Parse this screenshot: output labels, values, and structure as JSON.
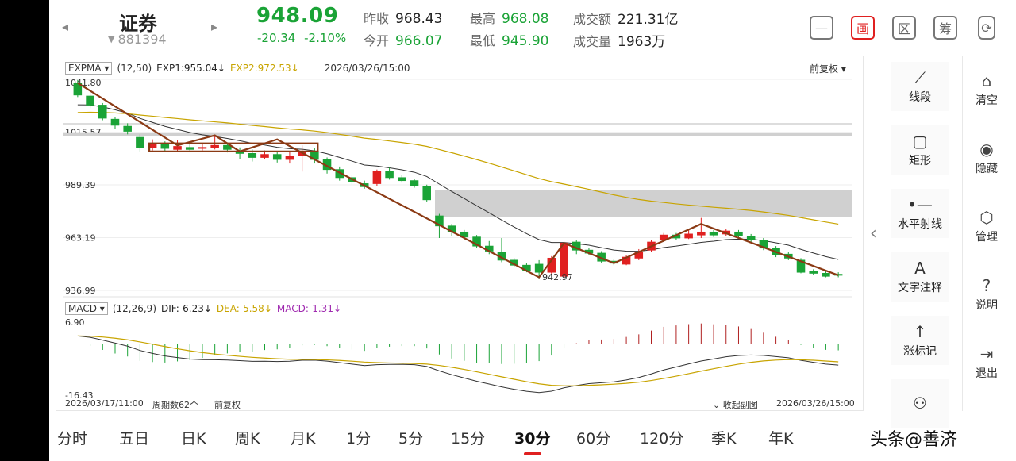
{
  "header": {
    "prev_arrow": "◂",
    "next_arrow": "▸",
    "stock_name": "证券",
    "stock_code": "881394",
    "price": "948.09",
    "change": "-20.34",
    "change_pct": "-2.10%",
    "quotes": [
      {
        "label": "昨收",
        "value": "968.43",
        "color": "black"
      },
      {
        "label": "最高",
        "value": "968.08",
        "color": "green"
      },
      {
        "label": "成交额",
        "value": "221.31亿",
        "color": "black"
      },
      {
        "label": "今开",
        "value": "966.07",
        "color": "green"
      },
      {
        "label": "最低",
        "value": "945.90",
        "color": "green"
      },
      {
        "label": "成交量",
        "value": "1963万",
        "color": "black"
      }
    ],
    "icons": [
      {
        "name": "minimize-icon",
        "glyph": "—"
      },
      {
        "name": "draw-icon",
        "glyph": "画"
      },
      {
        "name": "region-icon",
        "glyph": "区"
      },
      {
        "name": "chips-icon",
        "glyph": "筹"
      },
      {
        "name": "screen-rotate-icon",
        "glyph": "⟳"
      }
    ]
  },
  "legend": {
    "indicator": "EXPMA",
    "params": "(12,50)",
    "exp1": "EXP1:955.04",
    "exp2": "EXP2:972.53",
    "datetime": "2026/03/26/15:00",
    "adjust": "前复权"
  },
  "macd_legend": {
    "indicator": "MACD",
    "params": "(12,26,9)",
    "dif": "DIF:-6.23",
    "dea": "DEA:-5.58",
    "macd": "MACD:-1.31"
  },
  "footer": {
    "start": "2026/03/17/11:00",
    "period_count": "周期数62个",
    "adjust": "前复权",
    "collapse": "收起副图",
    "end": "2026/03/26/15:00"
  },
  "tools": [
    {
      "name": "line-segment",
      "icon": "⟋",
      "label": "线段"
    },
    {
      "name": "rectangle",
      "icon": "▢",
      "label": "矩形"
    },
    {
      "name": "horizontal-ray",
      "icon": "•—",
      "label": "水平射线"
    },
    {
      "name": "text-note",
      "icon": "A",
      "label": "文字注释"
    },
    {
      "name": "limit-up-mark",
      "icon": "↑",
      "label": "涨标记"
    },
    {
      "name": "more-tools",
      "icon": "⚇",
      "label": ""
    }
  ],
  "side_tools": [
    {
      "name": "clear",
      "icon": "⌂",
      "label": "清空"
    },
    {
      "name": "hide",
      "icon": "◉",
      "label": "隐藏"
    },
    {
      "name": "manage",
      "icon": "⬡",
      "label": "管理"
    },
    {
      "name": "help",
      "icon": "?",
      "label": "说明"
    },
    {
      "name": "exit",
      "icon": "⇥",
      "label": "退出"
    }
  ],
  "collapse_arrow": "‹",
  "tabs": [
    "分时",
    "五日",
    "日K",
    "周K",
    "月K",
    "1分",
    "5分",
    "15分",
    "30分",
    "60分",
    "120分",
    "季K",
    "年K"
  ],
  "active_tab": "30分",
  "watermark": "头条@善济",
  "chart_data": {
    "type": "candlestick",
    "y_axis_labels": [
      "1041.80",
      "1015.57",
      "989.39",
      "963.19",
      "936.99"
    ],
    "ylim": [
      936.99,
      1041.8
    ],
    "low_annotation": "942.97",
    "candles": [
      [
        1040.0,
        1034.0,
        1041.5,
        1033.0
      ],
      [
        1033.5,
        1029.0,
        1035.0,
        1027.5
      ],
      [
        1029.0,
        1022.5,
        1030.0,
        1021.5
      ],
      [
        1022.0,
        1019.0,
        1023.0,
        1017.0
      ],
      [
        1018.5,
        1016.0,
        1020.0,
        1014.5
      ],
      [
        1013.0,
        1008.0,
        1014.5,
        1006.0
      ],
      [
        1008.0,
        1009.5,
        1012.0,
        1006.5
      ],
      [
        1009.5,
        1007.5,
        1011.0,
        1006.0
      ],
      [
        1007.0,
        1008.5,
        1011.5,
        1006.0
      ],
      [
        1008.0,
        1007.0,
        1010.5,
        1006.0
      ],
      [
        1007.5,
        1008.0,
        1010.0,
        1006.5
      ],
      [
        1008.0,
        1009.0,
        1013.5,
        1007.0
      ],
      [
        1009.0,
        1007.0,
        1010.5,
        1005.5
      ],
      [
        1006.0,
        1005.0,
        1008.0,
        1002.0
      ],
      [
        1005.0,
        1003.0,
        1007.0,
        1001.0
      ],
      [
        1003.0,
        1004.5,
        1006.5,
        1002.0
      ],
      [
        1004.5,
        1002.0,
        1006.0,
        1000.5
      ],
      [
        1002.0,
        1003.5,
        1006.0,
        1000.0
      ],
      [
        1004.0,
        1005.5,
        1009.0,
        996.0
      ],
      [
        1006.0,
        1002.0,
        1007.5,
        1000.0
      ],
      [
        1002.0,
        997.0,
        1003.0,
        995.0
      ],
      [
        997.0,
        993.0,
        998.5,
        991.5
      ],
      [
        993.0,
        991.0,
        994.5,
        989.5
      ],
      [
        990.0,
        988.5,
        991.5,
        987.5
      ],
      [
        990.0,
        996.0,
        997.0,
        989.0
      ],
      [
        996.0,
        993.0,
        998.0,
        992.0
      ],
      [
        993.0,
        991.5,
        994.5,
        990.5
      ],
      [
        991.5,
        989.0,
        992.5,
        988.0
      ],
      [
        988.5,
        982.0,
        989.5,
        981.0
      ],
      [
        974.0,
        969.0,
        975.0,
        963.0
      ],
      [
        969.0,
        966.0,
        970.0,
        964.0
      ],
      [
        966.0,
        963.5,
        967.0,
        962.0
      ],
      [
        963.5,
        959.0,
        964.5,
        958.0
      ],
      [
        959.0,
        956.5,
        961.5,
        955.0
      ],
      [
        956.0,
        952.0,
        963.0,
        951.0
      ],
      [
        952.0,
        949.5,
        953.0,
        948.5
      ],
      [
        949.5,
        947.0,
        950.5,
        946.0
      ],
      [
        950.0,
        946.0,
        952.0,
        942.97
      ],
      [
        946.0,
        953.0,
        954.0,
        945.0
      ],
      [
        944.0,
        960.5,
        961.5,
        943.0
      ],
      [
        961.0,
        957.0,
        962.0,
        955.0
      ],
      [
        957.0,
        955.5,
        958.0,
        954.5
      ],
      [
        955.5,
        951.5,
        956.5,
        950.5
      ],
      [
        951.5,
        950.5,
        952.5,
        949.5
      ],
      [
        950.0,
        953.5,
        954.5,
        949.5
      ],
      [
        953.0,
        956.0,
        957.5,
        952.0
      ],
      [
        957.0,
        961.0,
        962.0,
        956.0
      ],
      [
        962.0,
        964.5,
        965.5,
        961.0
      ],
      [
        964.5,
        963.0,
        965.5,
        962.0
      ],
      [
        963.0,
        965.0,
        967.0,
        962.5
      ],
      [
        964.5,
        966.0,
        973.0,
        963.0
      ],
      [
        966.0,
        964.5,
        967.0,
        963.5
      ],
      [
        965.0,
        966.5,
        967.5,
        964.0
      ],
      [
        966.0,
        964.0,
        967.0,
        963.0
      ],
      [
        964.0,
        962.0,
        965.0,
        961.0
      ],
      [
        962.0,
        958.0,
        963.0,
        957.0
      ],
      [
        958.0,
        954.5,
        959.0,
        953.5
      ],
      [
        955.0,
        953.0,
        956.0,
        952.0
      ],
      [
        952.0,
        946.0,
        953.0,
        945.5
      ],
      [
        946.5,
        945.5,
        947.5,
        944.5
      ],
      [
        945.5,
        944.0,
        946.5,
        943.5
      ],
      [
        945.0,
        944.5,
        946.0,
        943.5
      ]
    ],
    "macd_axis_labels": [
      "6.90",
      "-16.43"
    ],
    "macd_ylim": [
      -16.43,
      6.9
    ]
  }
}
